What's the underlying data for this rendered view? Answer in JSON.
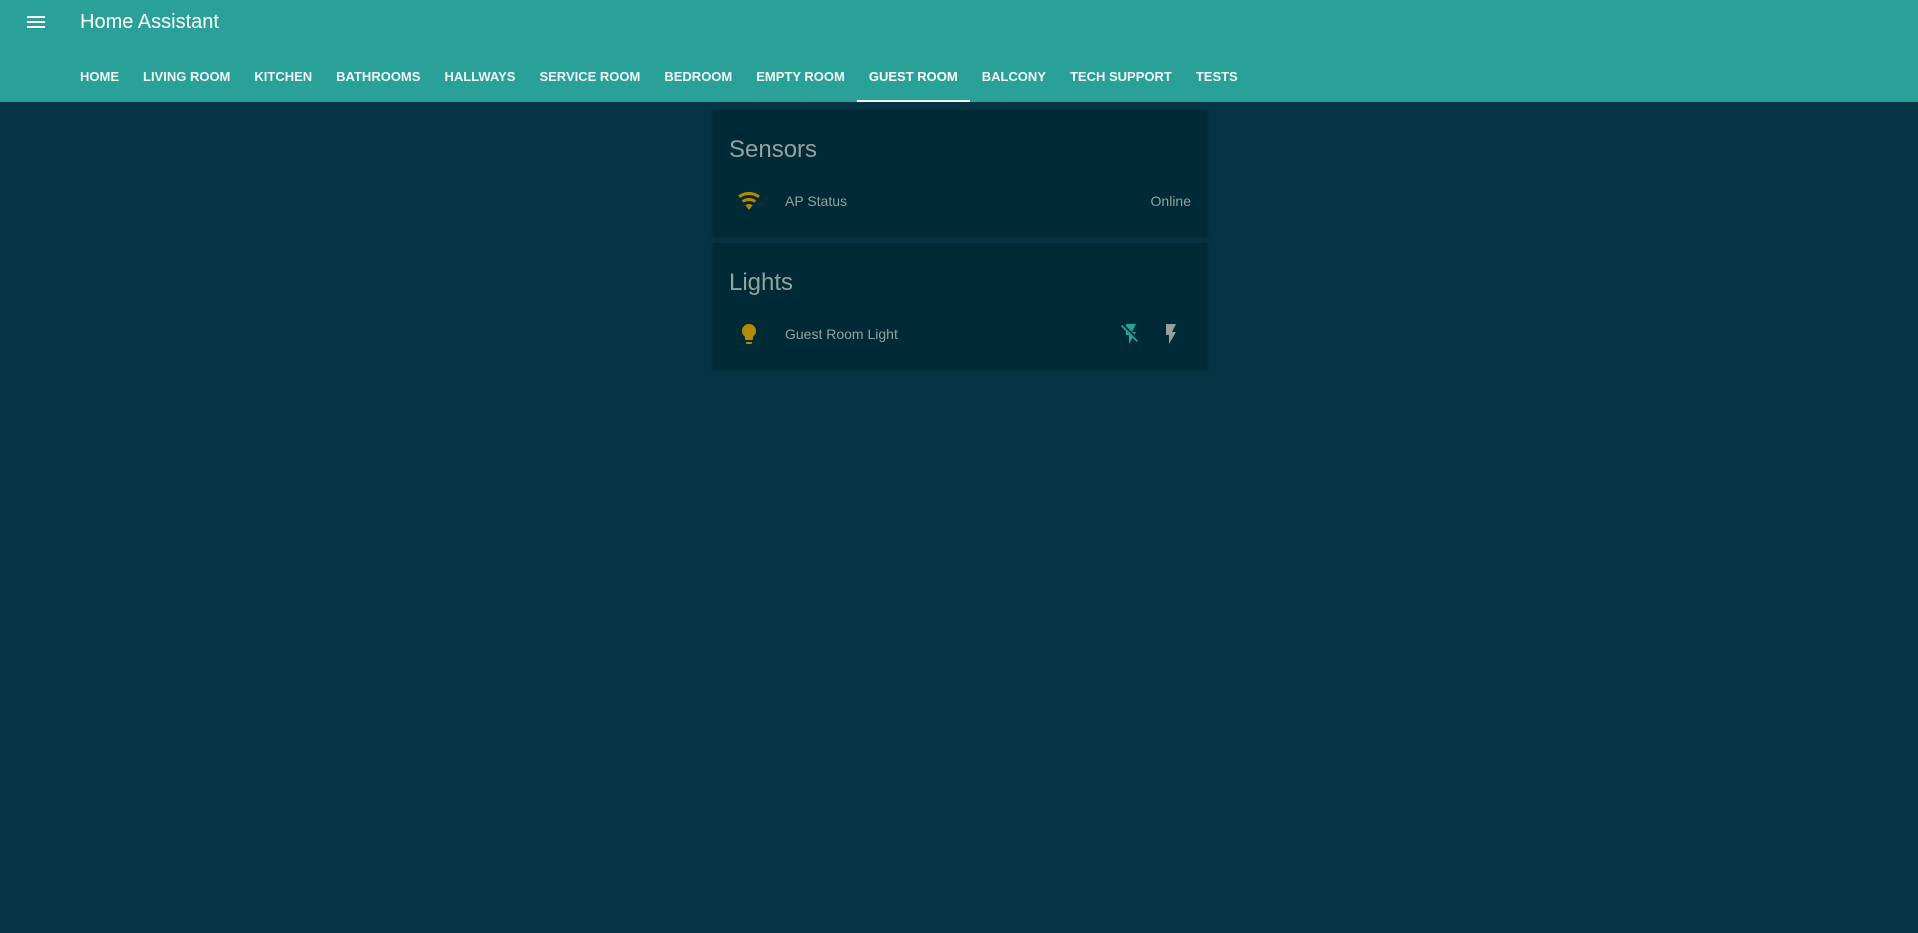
{
  "app": {
    "title": "Home Assistant"
  },
  "tabs": [
    {
      "label": "HOME"
    },
    {
      "label": "LIVING ROOM"
    },
    {
      "label": "KITCHEN"
    },
    {
      "label": "BATHROOMS"
    },
    {
      "label": "HALLWAYS"
    },
    {
      "label": "SERVICE ROOM"
    },
    {
      "label": "BEDROOM"
    },
    {
      "label": "EMPTY ROOM"
    },
    {
      "label": "GUEST ROOM",
      "active": true
    },
    {
      "label": "BALCONY"
    },
    {
      "label": "TECH SUPPORT"
    },
    {
      "label": "TESTS"
    }
  ],
  "cards": {
    "sensors": {
      "title": "Sensors",
      "entities": [
        {
          "name": "AP Status",
          "state": "Online",
          "icon": "wifi-icon"
        }
      ]
    },
    "lights": {
      "title": "Lights",
      "entities": [
        {
          "name": "Guest Room Light",
          "icon": "lightbulb-icon",
          "actions": [
            "flash-off-icon",
            "flash-icon"
          ]
        }
      ]
    }
  },
  "colors": {
    "header": "#2aa198",
    "background": "#073444",
    "card": "#002b36",
    "text": "#93a1a1",
    "icon_active": "#b58900",
    "action_off": "#2aa198",
    "action_on": "#93a1a1"
  }
}
